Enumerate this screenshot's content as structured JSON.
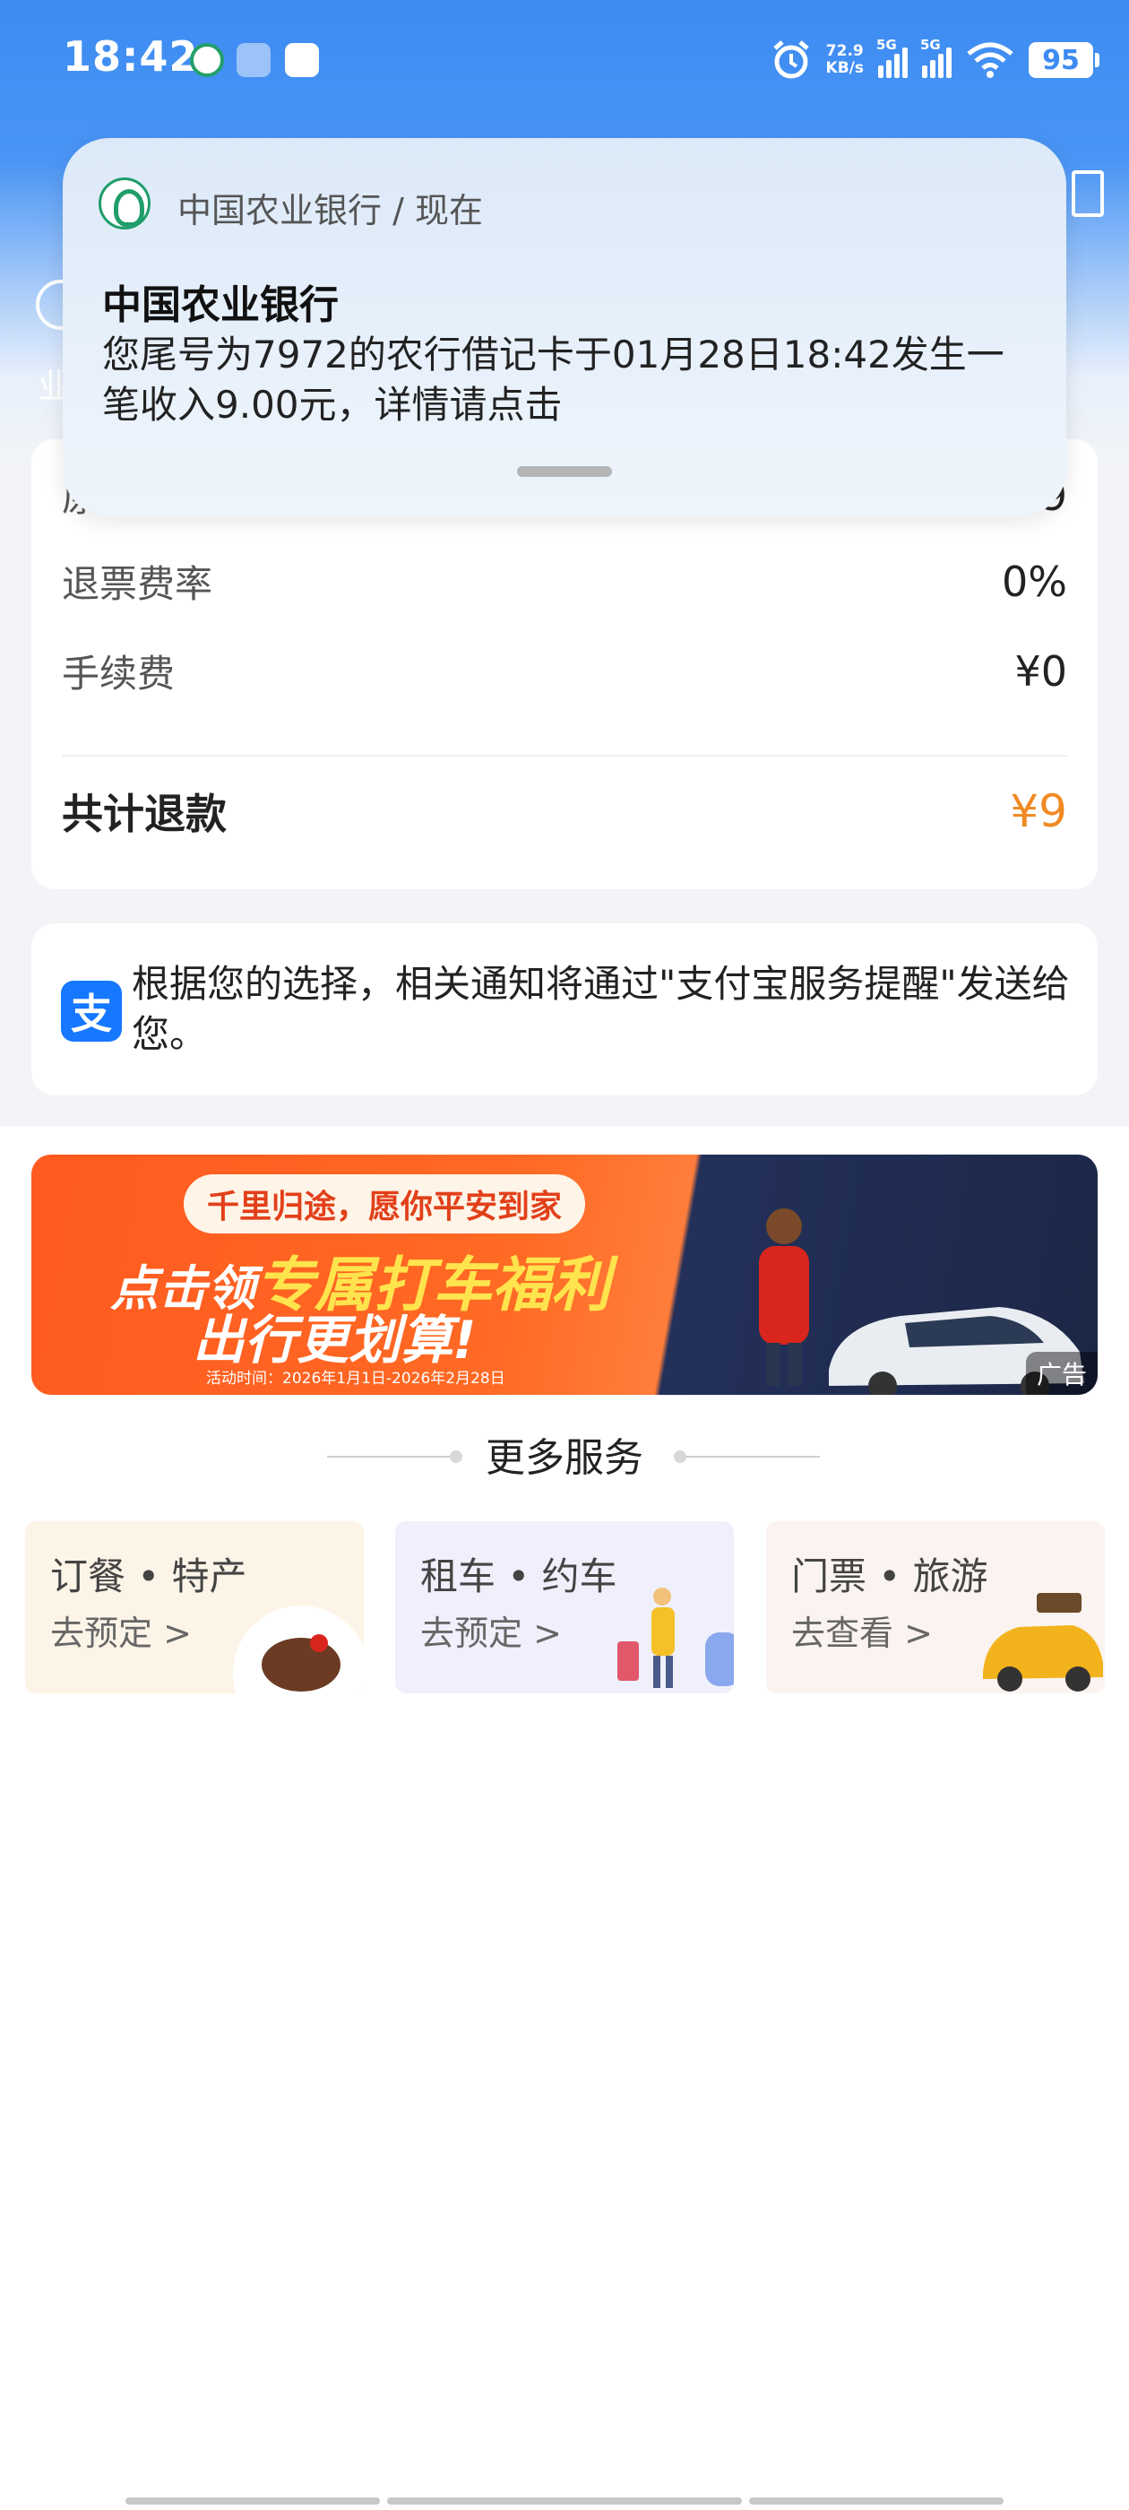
{
  "status_bar": {
    "time": "18:42",
    "speed_value": "72.9",
    "speed_unit": "KB/s",
    "signal1": "5G",
    "signal2": "5G",
    "battery": "95"
  },
  "header_peek": {
    "text": "业"
  },
  "notification": {
    "app_line": "中国农业银行 / 现在",
    "title": "中国农业银行",
    "body": "您尾号为7972的农行借记卡于01月28日18:42发生一笔收入9.00元，详情请点击"
  },
  "refund": {
    "rows": [
      {
        "label": "原票价",
        "value": "¥9"
      },
      {
        "label": "退票费率",
        "value": "0%"
      },
      {
        "label": "手续费",
        "value": "¥0"
      }
    ],
    "total_label": "共计退款",
    "total_value": "¥9",
    "accent_color": "#f08a24"
  },
  "notice": {
    "icon": "alipay-icon",
    "text": "根据您的选择，相关通知将通过\"支付宝服务提醒\"发送给您。"
  },
  "banner": {
    "pill": "千里归途，愿你平安到家",
    "line1_prefix": "点击领",
    "line1_highlight": "专属打车福利",
    "line2": "出行更划算!",
    "date": "活动时间：2026年1月1日-2026年2月28日",
    "ad_label": "广告"
  },
  "more_services": {
    "title": "更多服务",
    "items": [
      {
        "title": "订餐 • 特产",
        "action": "去预定 >"
      },
      {
        "title": "租车 • 约车",
        "action": "去预定 >"
      },
      {
        "title": "门票 • 旅游",
        "action": "去查看 >"
      }
    ]
  }
}
